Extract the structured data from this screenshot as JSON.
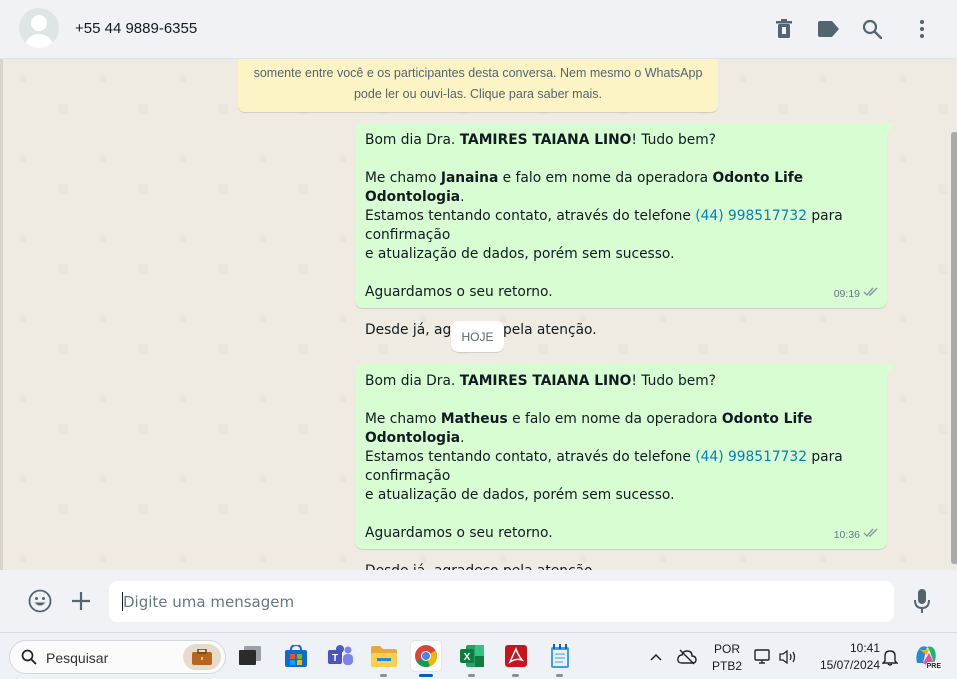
{
  "header": {
    "contact_name": "+55 44 9889-6355",
    "icons": [
      "delete-icon",
      "label-icon",
      "search-icon",
      "menu-icon"
    ]
  },
  "notice": {
    "line1": "somente entre você e os participantes desta conversa. Nem mesmo o WhatsApp",
    "line2": "pode ler ou ouvi-las. Clique para saber mais."
  },
  "messages": [
    {
      "greeting_pre": "Bom dia Dra. ",
      "doctor": "TAMIRES TAIANA LINO",
      "greeting_post": "! Tudo bem?",
      "intro_pre": "Me chamo ",
      "sender": "Janaina",
      "intro_mid": " e falo em nome da operadora ",
      "company": "Odonto Life Odontologia",
      "intro_post": ".",
      "contact_pre": "Estamos tentando contato, através do telefone ",
      "phone": "(44) 998517732",
      "contact_post": " para confirmação",
      "contact_line2": "e atualização de dados, porém sem sucesso.",
      "waiting": "Aguardamos o seu retorno.",
      "thanks": "Desde já, agradeço pela atenção.",
      "time": "09:19"
    },
    {
      "greeting_pre": "Bom dia Dra. ",
      "doctor": "TAMIRES TAIANA LINO",
      "greeting_post": "! Tudo bem?",
      "intro_pre": "Me chamo ",
      "sender": "Matheus",
      "intro_mid": " e falo em nome da operadora ",
      "company": "Odonto Life Odontologia",
      "intro_post": ".",
      "contact_pre": "Estamos tentando contato, através do telefone ",
      "phone": "(44) 998517732",
      "contact_post": " para confirmação",
      "contact_line2": "e atualização de dados, porém sem sucesso.",
      "waiting": "Aguardamos o seu retorno.",
      "thanks": "Desde já, agradeço pela atenção.",
      "time": "10:36"
    }
  ],
  "day_divider": "HOJE",
  "composer": {
    "placeholder": "Digite uma mensagem"
  },
  "taskbar": {
    "search_label": "Pesquisar",
    "apps": [
      "briefcase-icon",
      "task-view-icon",
      "store-icon",
      "teams-icon",
      "file-explorer-icon",
      "chrome-icon",
      "excel-icon",
      "acrobat-icon",
      "notepad-icon"
    ],
    "language_line1": "POR",
    "language_line2": "PTB2",
    "clock_time": "10:41",
    "clock_date": "15/07/2024",
    "copilot_badge": "PRE"
  },
  "colors": {
    "bubble_out": "#d9fdd3",
    "link": "#027eb5",
    "notice_bg": "#fdf4c5",
    "chat_bg": "#efeae2"
  }
}
